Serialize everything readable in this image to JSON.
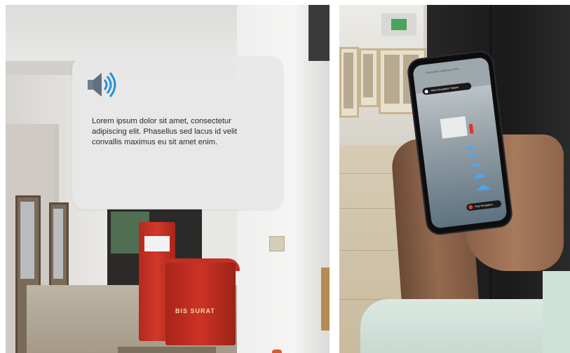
{
  "ar_card": {
    "icon": "speaker-icon",
    "text": "Lorem ipsum dolor sit amet, consectetur adipiscing elit. Phasellus sed lacus id velit convallis maximus eu sit amet enim."
  },
  "scene": {
    "postbox_label": "BIS SURAT"
  },
  "phone": {
    "title": "Successful Localization 100%",
    "show_targets_label": "Show Navigation Targets",
    "stop_label": "Stop Navigation"
  },
  "colors": {
    "card_bg": "#e8e8e8",
    "speaker_blue": "#2a8fd6",
    "postbox_red": "#c9301f",
    "nav_arrow": "#47a7ff",
    "stop_red": "#e33b2f"
  }
}
